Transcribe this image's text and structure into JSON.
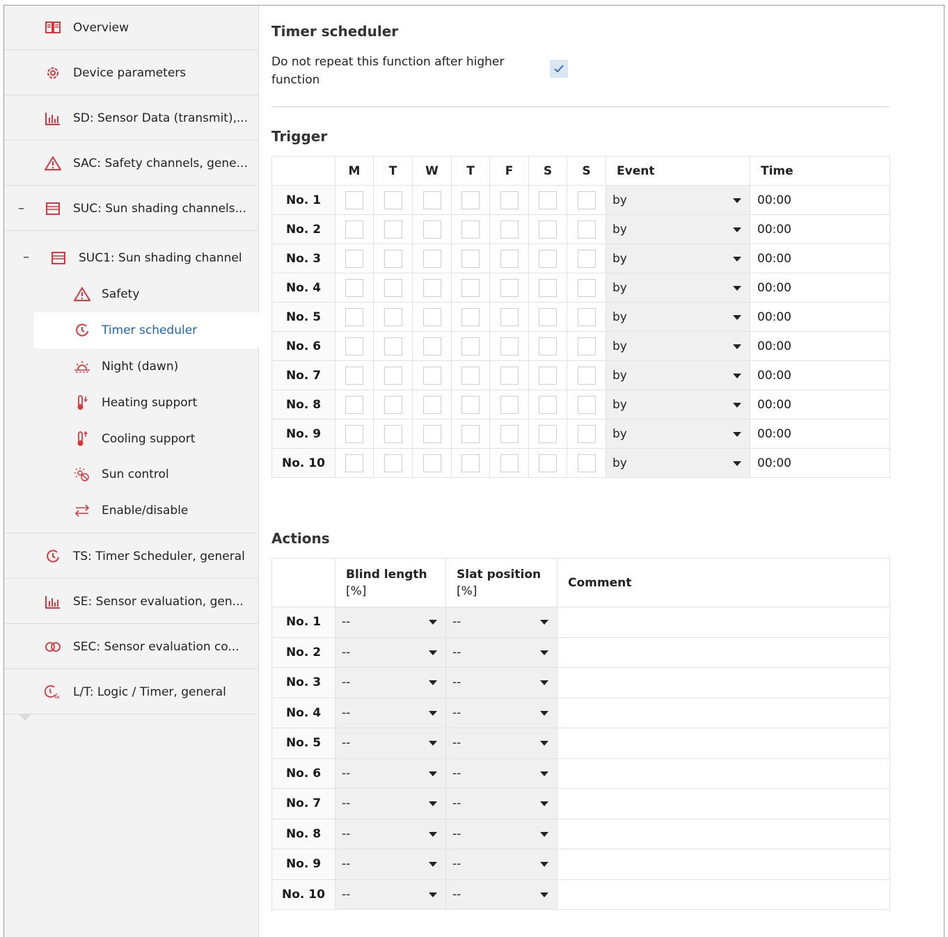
{
  "sidebar": {
    "items": [
      {
        "label": "Overview",
        "icon": "book-icon"
      },
      {
        "label": "Device parameters",
        "icon": "gear-icon"
      },
      {
        "label": "SD: Sensor Data (transmit),...",
        "icon": "bar-chart-icon"
      },
      {
        "label": "SAC: Safety channels, gene...",
        "icon": "warning-icon"
      },
      {
        "label": "SUC: Sun shading channels...",
        "icon": "blind-icon"
      }
    ],
    "suc1": {
      "label": "SUC1:  Sun shading channel",
      "icon": "blind-icon"
    },
    "sub_items": [
      {
        "label": "Safety",
        "icon": "warning-icon"
      },
      {
        "label": "Timer scheduler",
        "icon": "clock-icon",
        "active": true
      },
      {
        "label": "Night (dawn)",
        "icon": "sunrise-icon"
      },
      {
        "label": "Heating support",
        "icon": "thermometer-down-icon"
      },
      {
        "label": "Cooling support",
        "icon": "thermometer-up-icon"
      },
      {
        "label": "Sun control",
        "icon": "sun-control-icon"
      },
      {
        "label": "Enable/disable",
        "icon": "swap-icon"
      }
    ],
    "bottom_items": [
      {
        "label": "TS: Timer Scheduler, general",
        "icon": "clock-icon"
      },
      {
        "label": "SE: Sensor evaluation, gen...",
        "icon": "bar-chart-icon"
      },
      {
        "label": "SEC: Sensor evaluation co...",
        "icon": "rings-icon"
      },
      {
        "label": "L/T: Logic / Timer, general",
        "icon": "logic-timer-icon"
      }
    ],
    "collapse_symbol": "–"
  },
  "page": {
    "title": "Timer scheduler",
    "option_label": "Do not repeat this function after higher function",
    "option_checked": true,
    "accent": "#1f66b0",
    "icon_color": "#d9363e"
  },
  "trigger": {
    "title": "Trigger",
    "headers": [
      "M",
      "T",
      "W",
      "T",
      "F",
      "S",
      "S",
      "Event",
      "Time"
    ],
    "rows": [
      {
        "label": "No. 1",
        "event": "by",
        "time": "00:00"
      },
      {
        "label": "No. 2",
        "event": "by",
        "time": "00:00"
      },
      {
        "label": "No. 3",
        "event": "by",
        "time": "00:00"
      },
      {
        "label": "No. 4",
        "event": "by",
        "time": "00:00"
      },
      {
        "label": "No. 5",
        "event": "by",
        "time": "00:00"
      },
      {
        "label": "No. 6",
        "event": "by",
        "time": "00:00"
      },
      {
        "label": "No. 7",
        "event": "by",
        "time": "00:00"
      },
      {
        "label": "No. 8",
        "event": "by",
        "time": "00:00"
      },
      {
        "label": "No. 9",
        "event": "by",
        "time": "00:00"
      },
      {
        "label": "No. 10",
        "event": "by",
        "time": "00:00"
      }
    ]
  },
  "actions": {
    "title": "Actions",
    "headers": {
      "blind_1": "Blind length",
      "blind_2": "[%]",
      "slat_1": "Slat position",
      "slat_2": "[%]",
      "comment": "Comment"
    },
    "rows": [
      {
        "label": "No. 1",
        "blind": "--",
        "slat": "--",
        "comment": ""
      },
      {
        "label": "No. 2",
        "blind": "--",
        "slat": "--",
        "comment": ""
      },
      {
        "label": "No. 3",
        "blind": "--",
        "slat": "--",
        "comment": ""
      },
      {
        "label": "No. 4",
        "blind": "--",
        "slat": "--",
        "comment": ""
      },
      {
        "label": "No. 5",
        "blind": "--",
        "slat": "--",
        "comment": ""
      },
      {
        "label": "No. 6",
        "blind": "--",
        "slat": "--",
        "comment": ""
      },
      {
        "label": "No. 7",
        "blind": "--",
        "slat": "--",
        "comment": ""
      },
      {
        "label": "No. 8",
        "blind": "--",
        "slat": "--",
        "comment": ""
      },
      {
        "label": "No. 9",
        "blind": "--",
        "slat": "--",
        "comment": ""
      },
      {
        "label": "No. 10",
        "blind": "--",
        "slat": "--",
        "comment": ""
      }
    ]
  }
}
